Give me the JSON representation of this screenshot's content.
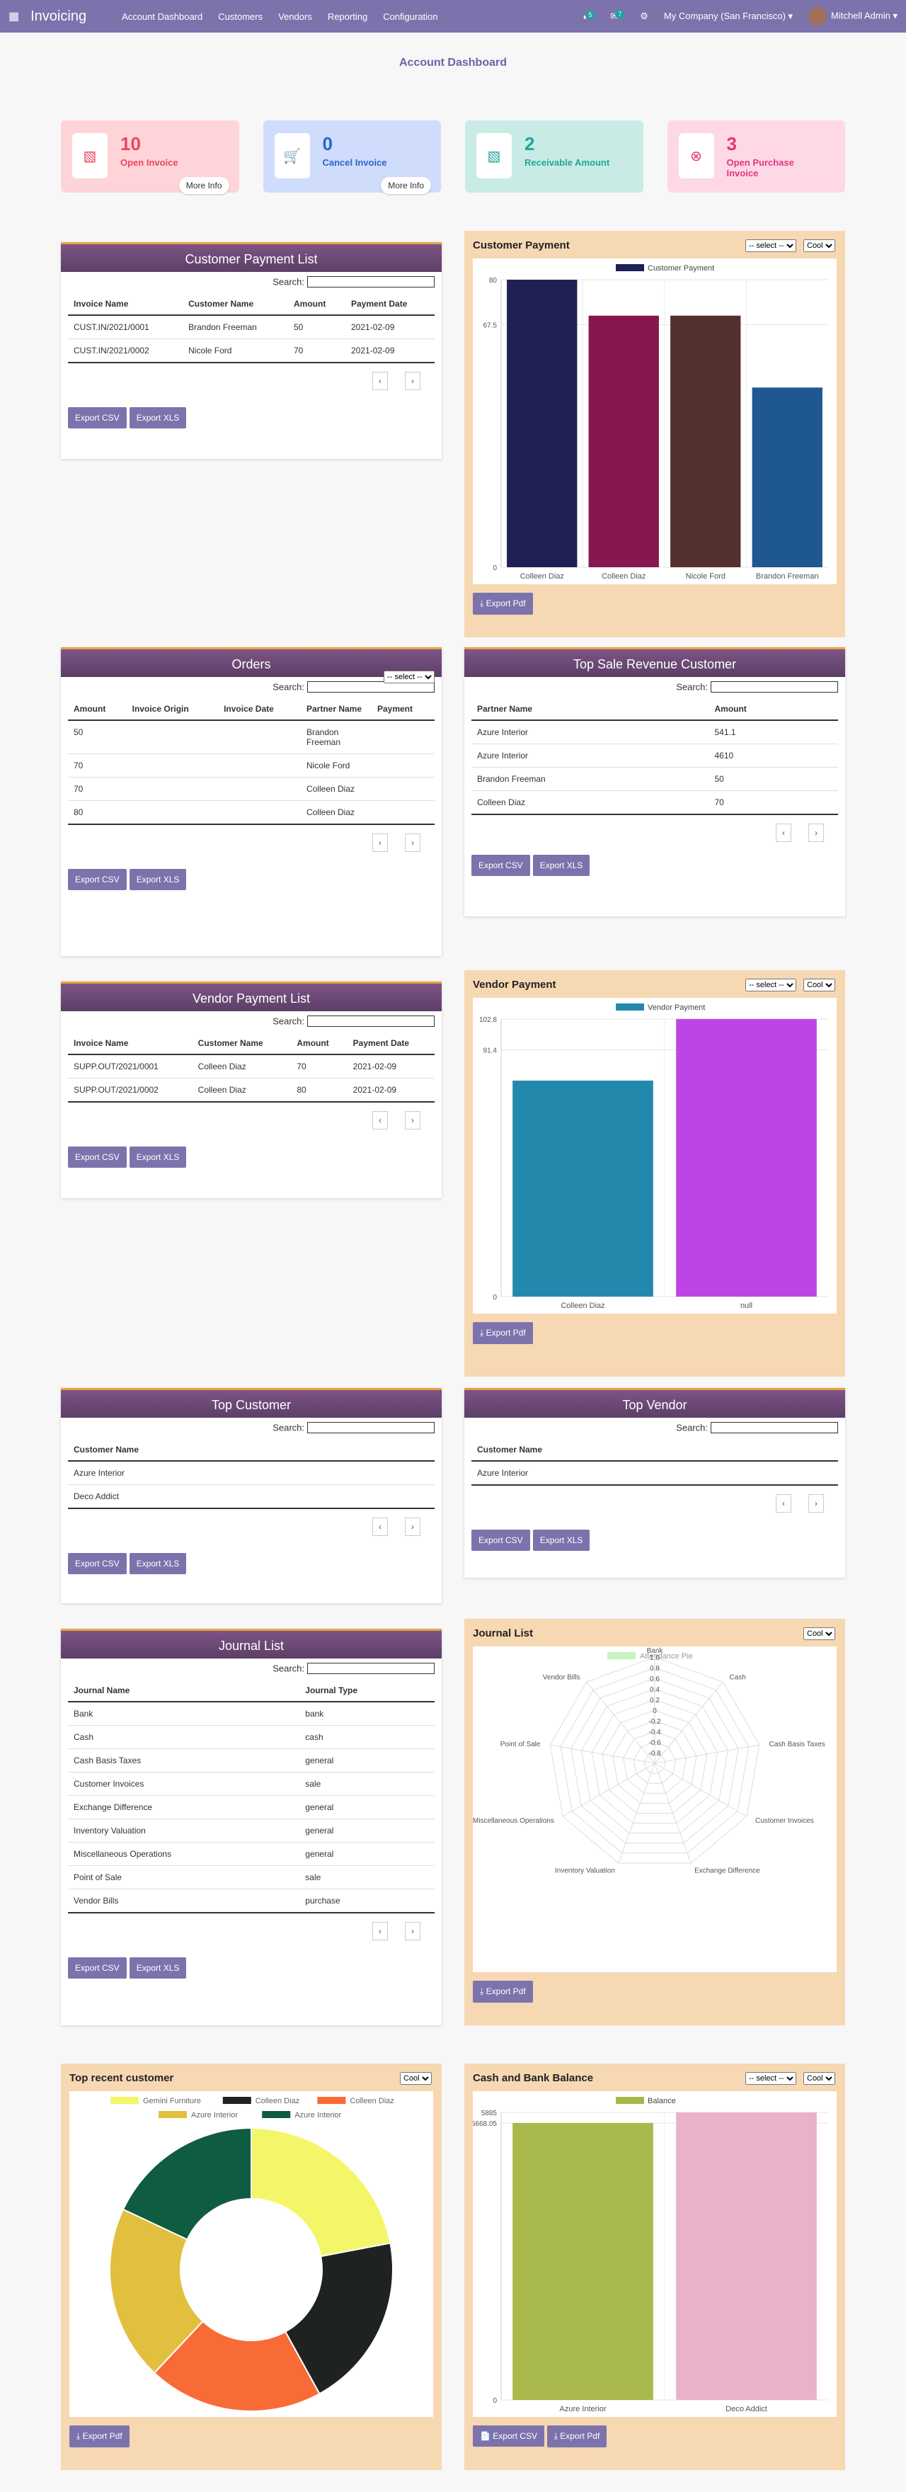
{
  "nav": {
    "apps_icon": "grid-icon",
    "brand": "Invoicing",
    "menu": [
      "Account Dashboard",
      "Customers",
      "Vendors",
      "Reporting",
      "Configuration"
    ],
    "badge1": "5",
    "badge2": "7",
    "company": "My Company (San Francisco)",
    "user": "Mitchell Admin"
  },
  "dashboard": {
    "title": "Account Dashboard"
  },
  "tiles": [
    {
      "num": "10",
      "label": "Open Invoice",
      "more": "More Info",
      "color": "#e8475f",
      "bg": "#ffd4d8"
    },
    {
      "num": "0",
      "label": "Cancel Invoice",
      "more": "More Info",
      "color": "#2a66c9",
      "bg": "#cfdcfb"
    },
    {
      "num": "2",
      "label": "Receivable Amount",
      "color": "#23a59a",
      "bg": "#c8ece5"
    },
    {
      "num": "3",
      "label": "Open Purchase Invoice",
      "color": "#e0377c",
      "bg": "#ffd8e6"
    }
  ],
  "common": {
    "search": "Search:",
    "export_csv": "Export CSV",
    "export_xls": "Export XLS",
    "export_pdf": "Export Pdf",
    "prev": "‹",
    "next": "›",
    "select_default": "-- select --",
    "theme": "Cool"
  },
  "customer_payment_list": {
    "title": "Customer Payment List",
    "headers": [
      "Invoice Name",
      "Customer Name",
      "Amount",
      "Payment Date"
    ],
    "rows": [
      [
        "CUST.IN/2021/0001",
        "Brandon Freeman",
        "50",
        "2021-02-09"
      ],
      [
        "CUST.IN/2021/0002",
        "Nicole Ford",
        "70",
        "2021-02-09"
      ]
    ]
  },
  "orders": {
    "title": "Orders",
    "headers": [
      "Amount",
      "Invoice Origin",
      "Invoice Date",
      "Partner Name",
      "Payment"
    ],
    "rows": [
      [
        "50",
        "",
        "",
        "Brandon Freeman",
        ""
      ],
      [
        "70",
        "",
        "",
        "Nicole Ford",
        ""
      ],
      [
        "70",
        "",
        "",
        "Colleen Diaz",
        ""
      ],
      [
        "80",
        "",
        "",
        "Colleen Diaz",
        ""
      ]
    ]
  },
  "top_sale": {
    "title": "Top Sale Revenue Customer",
    "headers": [
      "Partner Name",
      "Amount"
    ],
    "rows": [
      [
        "Azure Interior",
        "541.1"
      ],
      [
        "Azure Interior",
        "4610"
      ],
      [
        "Brandon Freeman",
        "50"
      ],
      [
        "Colleen Diaz",
        "70"
      ]
    ]
  },
  "vendor_payment_list": {
    "title": "Vendor Payment List",
    "headers": [
      "Invoice Name",
      "Customer Name",
      "Amount",
      "Payment Date"
    ],
    "rows": [
      [
        "SUPP.OUT/2021/0001",
        "Colleen Diaz",
        "70",
        "2021-02-09"
      ],
      [
        "SUPP.OUT/2021/0002",
        "Colleen Diaz",
        "80",
        "2021-02-09"
      ]
    ]
  },
  "top_customer": {
    "title": "Top Customer",
    "headers": [
      "Customer Name"
    ],
    "rows": [
      [
        "Azure Interior"
      ],
      [
        "Deco Addict"
      ]
    ]
  },
  "top_vendor": {
    "title": "Top Vendor",
    "headers": [
      "Customer Name"
    ],
    "rows": [
      [
        "Azure Interior"
      ]
    ]
  },
  "journal_list": {
    "title": "Journal List",
    "headers": [
      "Journal Name",
      "Journal Type"
    ],
    "rows": [
      [
        "Bank",
        "bank"
      ],
      [
        "Cash",
        "cash"
      ],
      [
        "Cash Basis Taxes",
        "general"
      ],
      [
        "Customer Invoices",
        "sale"
      ],
      [
        "Exchange Difference",
        "general"
      ],
      [
        "Inventory Valuation",
        "general"
      ],
      [
        "Miscellaneous Operations",
        "general"
      ],
      [
        "Point of Sale",
        "sale"
      ],
      [
        "Vendor Bills",
        "purchase"
      ]
    ]
  },
  "chart_data": [
    {
      "type": "bar",
      "title": "Customer Payment",
      "categories": [
        "Colleen Diaz",
        "Colleen Diaz",
        "Nicole Ford",
        "Brandon Freeman"
      ],
      "series": [
        {
          "name": "Customer Payment",
          "values": [
            80,
            70,
            70,
            50
          ]
        }
      ],
      "colors": [
        "#1f2155",
        "#86184e",
        "#54302e",
        "#1f5891"
      ],
      "ylim": [
        0,
        80
      ],
      "yticks": [
        "0",
        "67.5",
        "80"
      ]
    },
    {
      "type": "bar",
      "title": "Vendor Payment",
      "categories": [
        "Colleen Diaz",
        "null"
      ],
      "series": [
        {
          "name": "Vendor Payment",
          "values": [
            80,
            102.8
          ]
        }
      ],
      "colors": [
        "#2389ac",
        "#bd45e6"
      ],
      "ylim": [
        0,
        102.8
      ],
      "yticks": [
        "0",
        "91.4",
        "102.8"
      ]
    },
    {
      "type": "radar",
      "title": "Journal List",
      "series": [
        {
          "name": "Attendance Pie",
          "values": [
            0,
            0,
            0,
            0,
            0,
            0,
            0,
            0,
            0
          ]
        }
      ],
      "categories": [
        "Bank",
        "Cash",
        "Cash Basis Taxes",
        "Customer Invoices",
        "Exchange Difference",
        "Inventory Valuation",
        "Miscellaneous Operations",
        "Point of Sale",
        "Vendor Bills"
      ],
      "ticks": [
        "1.0",
        "0.8",
        "0.6",
        "0.4",
        "0.2",
        "0",
        "-0.2",
        "-0.4",
        "-0.6",
        "-0.8"
      ]
    },
    {
      "type": "pie",
      "title": "Top recent customer",
      "categories": [
        "Gemini Furniture",
        "Colleen Diaz",
        "Colleen Diaz",
        "Azure Interior",
        "Azure Interior"
      ],
      "values": [
        22,
        20,
        20,
        20,
        18
      ],
      "colors": [
        "#f4f66a",
        "#1e2220",
        "#f96b36",
        "#e2bf3e",
        "#0f5c40"
      ]
    },
    {
      "type": "bar",
      "title": "Cash and Bank Balance",
      "categories": [
        "Azure Interior",
        "Deco Addict"
      ],
      "series": [
        {
          "name": "Balance",
          "values": [
            5668.05,
            5885
          ]
        }
      ],
      "colors": [
        "#a9b84a",
        "#e9b2c9"
      ],
      "ylim": [
        0,
        5885
      ],
      "yticks": [
        "0",
        "5668.05",
        "5885"
      ],
      "extra_button": "Export CSV"
    }
  ]
}
